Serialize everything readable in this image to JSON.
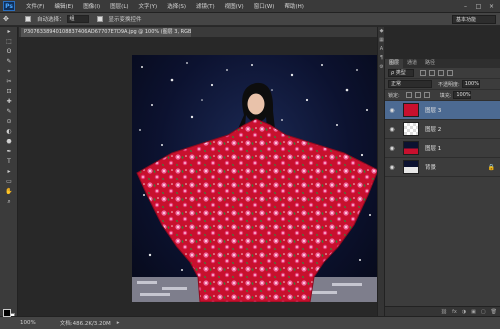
{
  "app": {
    "logo": "Ps"
  },
  "menu": [
    "文件(F)",
    "编辑(E)",
    "图像(I)",
    "图层(L)",
    "文字(Y)",
    "选择(S)",
    "滤镜(T)",
    "视图(V)",
    "窗口(W)",
    "帮助(H)"
  ],
  "window_controls": [
    "–",
    "□",
    "×"
  ],
  "options": {
    "tool_icon": "move-tool-icon",
    "auto_select_label": "自动选择：",
    "auto_select_value": "组",
    "show_transform_label": "显示变换控件",
    "workspace": "基本功能"
  },
  "tools": [
    "▸",
    "⬚",
    "ʘ",
    "✎",
    "⌖",
    "✂",
    "⊡",
    "✚",
    "✎",
    "⊙",
    "◐",
    "⬣",
    "✒",
    "T",
    "▸",
    "▭",
    "✋",
    "⌕"
  ],
  "document": {
    "tab_title": "P3076338940108837406AD67707E7D9A.jpg @ 100% (图层 3, RGB/8#) *"
  },
  "status": {
    "zoom": "100%",
    "doc_size": "文档:486.2K/3.20M",
    "arrow": "▸"
  },
  "dock_icons": [
    "◆",
    "▦",
    "A",
    "¶",
    "⚙"
  ],
  "panel": {
    "tabs": [
      "图层",
      "通道",
      "路径"
    ],
    "filter_kind": "ρ 类型",
    "blend_mode": "正常",
    "opacity_label": "不透明度:",
    "opacity_value": "100%",
    "lock_label": "锁定:",
    "fill_label": "填充:",
    "fill_value": "100%",
    "footer_icons": [
      "⛓",
      "fx",
      "◑",
      "▣",
      "▢",
      "🗑"
    ]
  },
  "layers": [
    {
      "name": "图层 3",
      "selected": true,
      "lock": ""
    },
    {
      "name": "图层 2",
      "selected": false,
      "lock": ""
    },
    {
      "name": "图层 1",
      "selected": false,
      "lock": ""
    },
    {
      "name": "背景",
      "selected": false,
      "lock": "🔒"
    }
  ],
  "colors": {
    "dress_red": "#c8102e",
    "selection_blue": "#4c6a92",
    "night_sky": "#0c1230"
  }
}
